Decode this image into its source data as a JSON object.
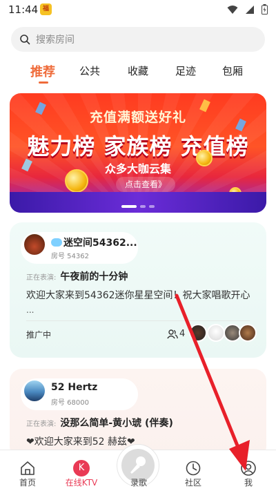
{
  "status_bar": {
    "time": "11:44",
    "app_badge": "福"
  },
  "search": {
    "placeholder": "搜索房间"
  },
  "tabs": [
    {
      "label": "推荐",
      "active": true
    },
    {
      "label": "公共",
      "active": false
    },
    {
      "label": "收藏",
      "active": false
    },
    {
      "label": "足迹",
      "active": false
    },
    {
      "label": "包厢",
      "active": false
    }
  ],
  "banner": {
    "subtitle": "充值满额送好礼",
    "headline": "魅力榜 家族榜 充值榜",
    "tagline": "众多大咖云集",
    "cta": "点击查看》",
    "dots": 3,
    "active_dot": 0
  },
  "rooms": [
    {
      "name": "迷空间54362...",
      "room_id": "房号 54362",
      "now_label": "正在表演:",
      "song": "午夜前的十分钟",
      "welcome": "欢迎大家来到54362迷你星星空间！祝大家唱歌开心",
      "ellipsis": "...",
      "promo": "推广中",
      "listeners": "4"
    },
    {
      "name": "52 Hertz",
      "room_id": "房号 68000",
      "now_label": "正在表演:",
      "song": "没那么简单-黄小琥 (伴奏)",
      "welcome": "❤欢迎大家来到52 赫兹❤"
    }
  ],
  "nav": {
    "home": "首页",
    "ktv": "在线KTV",
    "ktv_badge": "K",
    "record": "录歌",
    "community": "社区",
    "me": "我"
  },
  "colors": {
    "accent": "#ef6b3a",
    "nav_active": "#e93a55",
    "arrow": "#e8202a"
  }
}
